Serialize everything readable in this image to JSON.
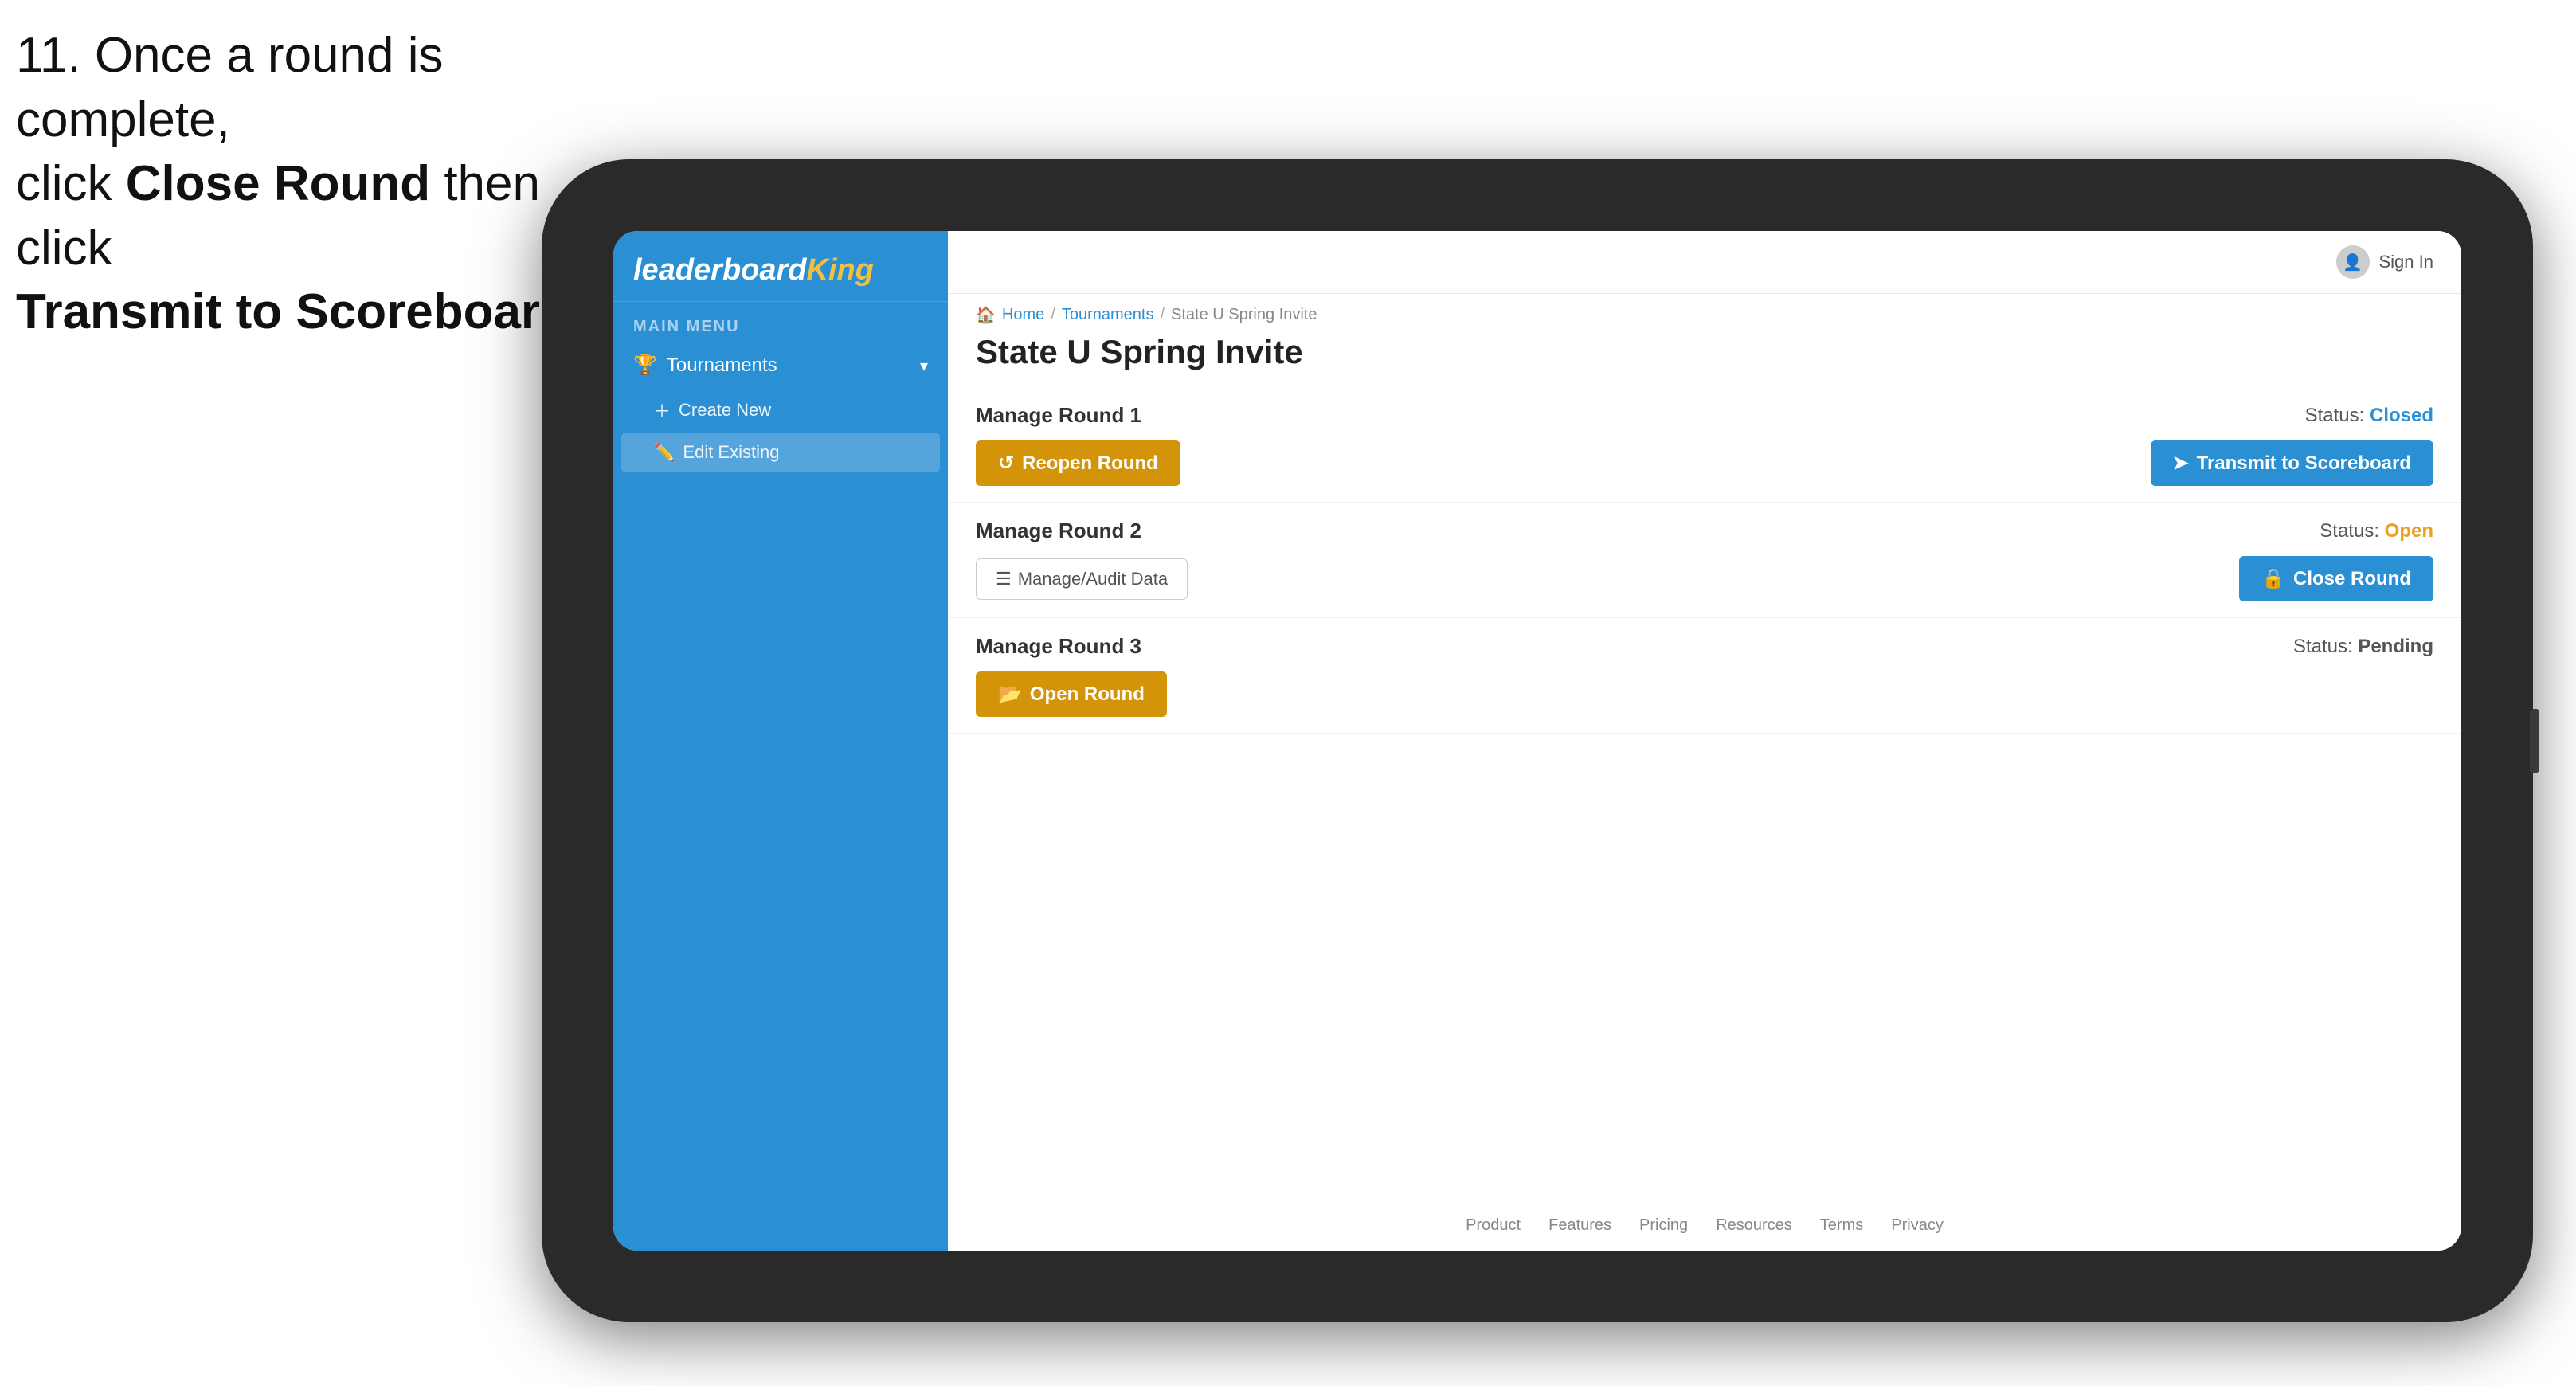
{
  "instruction": {
    "line1": "11. Once a round is complete,",
    "line2": "click ",
    "bold1": "Close Round",
    "line3": " then click",
    "bold2": "Transmit to Scoreboard."
  },
  "app": {
    "logo": {
      "leaderboard": "leaderboard",
      "king": "King"
    },
    "sidebar": {
      "main_menu_label": "MAIN MENU",
      "tournaments_label": "Tournaments",
      "create_new_label": "Create New",
      "edit_existing_label": "Edit Existing"
    },
    "topbar": {
      "sign_in_label": "Sign In"
    },
    "breadcrumb": {
      "home": "Home",
      "sep1": "/",
      "tournaments": "Tournaments",
      "sep2": "/",
      "current": "State U Spring Invite"
    },
    "page_title": "State U Spring Invite",
    "rounds": [
      {
        "title": "Manage Round 1",
        "status_label": "Status:",
        "status_value": "Closed",
        "status_type": "closed",
        "left_button": {
          "label": "Reopen Round",
          "type": "gold"
        },
        "right_button": {
          "label": "Transmit to Scoreboard",
          "type": "blue"
        }
      },
      {
        "title": "Manage Round 2",
        "status_label": "Status:",
        "status_value": "Open",
        "status_type": "open",
        "left_button": {
          "label": "Manage/Audit Data",
          "type": "outline"
        },
        "right_button": {
          "label": "Close Round",
          "type": "blue"
        }
      },
      {
        "title": "Manage Round 3",
        "status_label": "Status:",
        "status_value": "Pending",
        "status_type": "pending",
        "left_button": {
          "label": "Open Round",
          "type": "gold"
        },
        "right_button": null
      }
    ],
    "footer": {
      "links": [
        "Product",
        "Features",
        "Pricing",
        "Resources",
        "Terms",
        "Privacy"
      ]
    }
  },
  "colors": {
    "blue": "#2b8fd4",
    "gold": "#d4940a",
    "closed_status": "#2b8fd4",
    "open_status": "#e8a020",
    "pending_status": "#555555"
  }
}
